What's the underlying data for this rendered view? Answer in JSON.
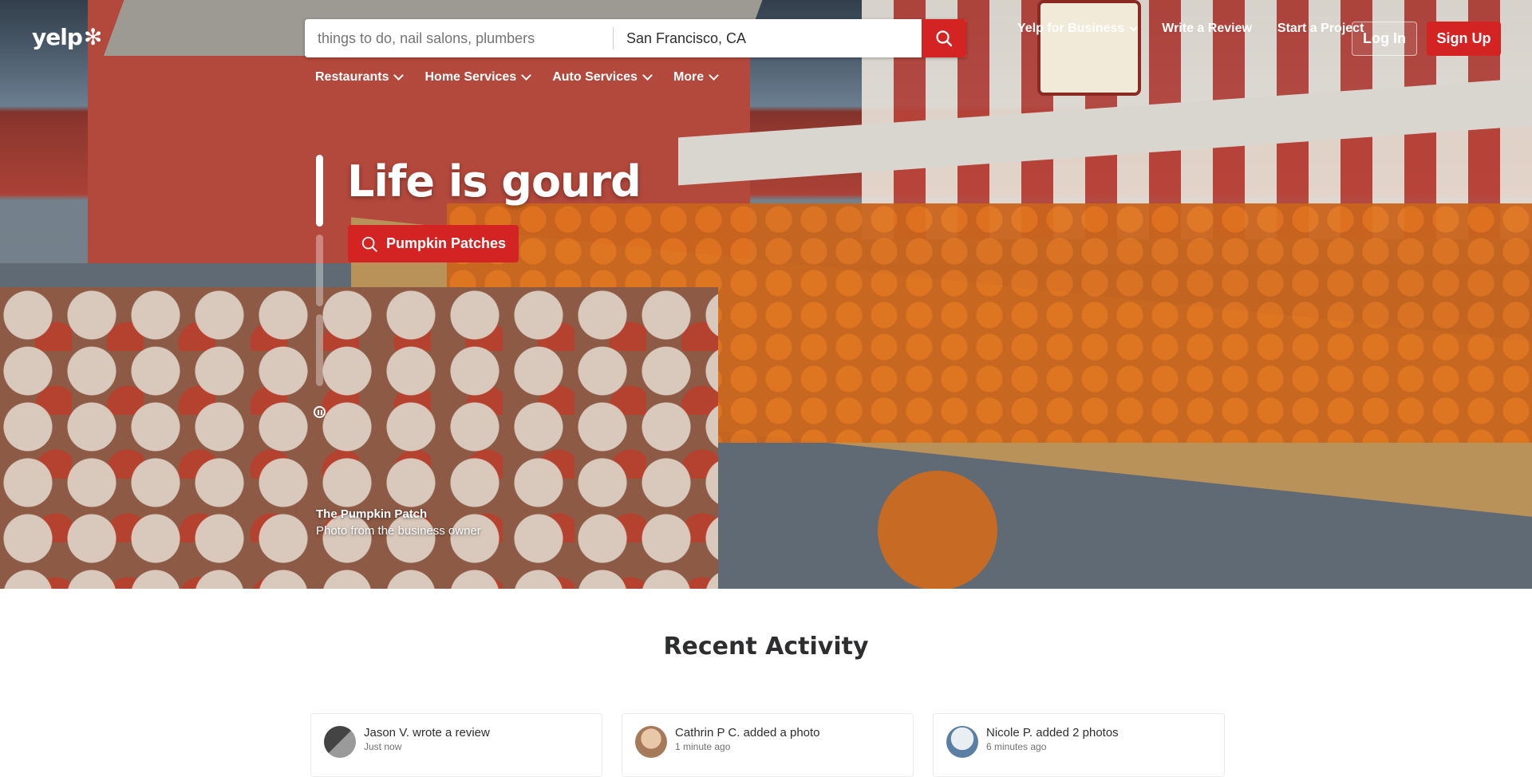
{
  "brand": {
    "logo_text": "yelp",
    "logo_icon": "yelp-burst-icon"
  },
  "search": {
    "find_placeholder": "things to do, nail salons, plumbers",
    "near_value": "San Francisco, CA",
    "submit_icon": "search-icon"
  },
  "categories": [
    {
      "label": "Restaurants"
    },
    {
      "label": "Home Services"
    },
    {
      "label": "Auto Services"
    },
    {
      "label": "More"
    }
  ],
  "topnav": {
    "business": "Yelp for Business",
    "write_review": "Write a Review",
    "start_project": "Start a Project",
    "login": "Log In",
    "signup": "Sign Up"
  },
  "hero": {
    "headline": "Life is gourd",
    "cta_label": "Pumpkin Patches",
    "photo_business": "The Pumpkin Patch",
    "photo_caption": "Photo from the business owner",
    "slide_count": 3,
    "active_slide": 1
  },
  "recent": {
    "title": "Recent Activity",
    "items": [
      {
        "who": "Jason V. wrote a review",
        "when": "Just now"
      },
      {
        "who": "Cathrin P C. added a photo",
        "when": "1 minute ago"
      },
      {
        "who": "Nicole P. added 2 photos",
        "when": "6 minutes ago"
      }
    ]
  },
  "colors": {
    "brand_red": "#d32323",
    "text_dark": "#2d2e2f"
  }
}
